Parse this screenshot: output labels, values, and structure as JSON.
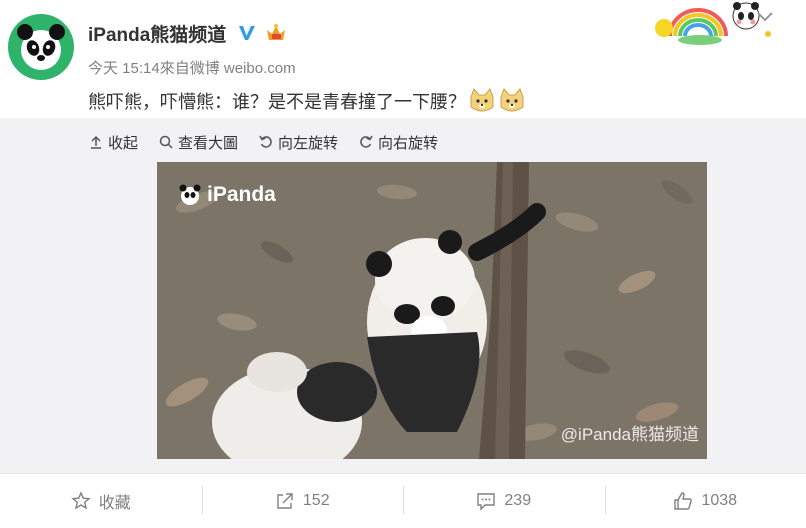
{
  "post": {
    "username": "iPanda熊猫频道",
    "meta": "今天 15:14來自微博 weibo.com",
    "text": "熊吓熊，吓懵熊：谁？是不是青春撞了一下腰？"
  },
  "toolbar": {
    "collapse": "收起",
    "view_large": "查看大圖",
    "rotate_left": "向左旋转",
    "rotate_right": "向右旋转"
  },
  "photo": {
    "watermark_logo": "iPanda",
    "watermark_corner": "@iPanda熊猫频道"
  },
  "actions": {
    "favorite": "收藏",
    "repost_count": "152",
    "comment_count": "239",
    "like_count": "1038"
  },
  "colors": {
    "avatar_bg": "#2fb36b",
    "media_bg": "#f2f2f5",
    "muted_text": "#808080",
    "verified": "#2e9de6",
    "vip": "#f59a23"
  }
}
